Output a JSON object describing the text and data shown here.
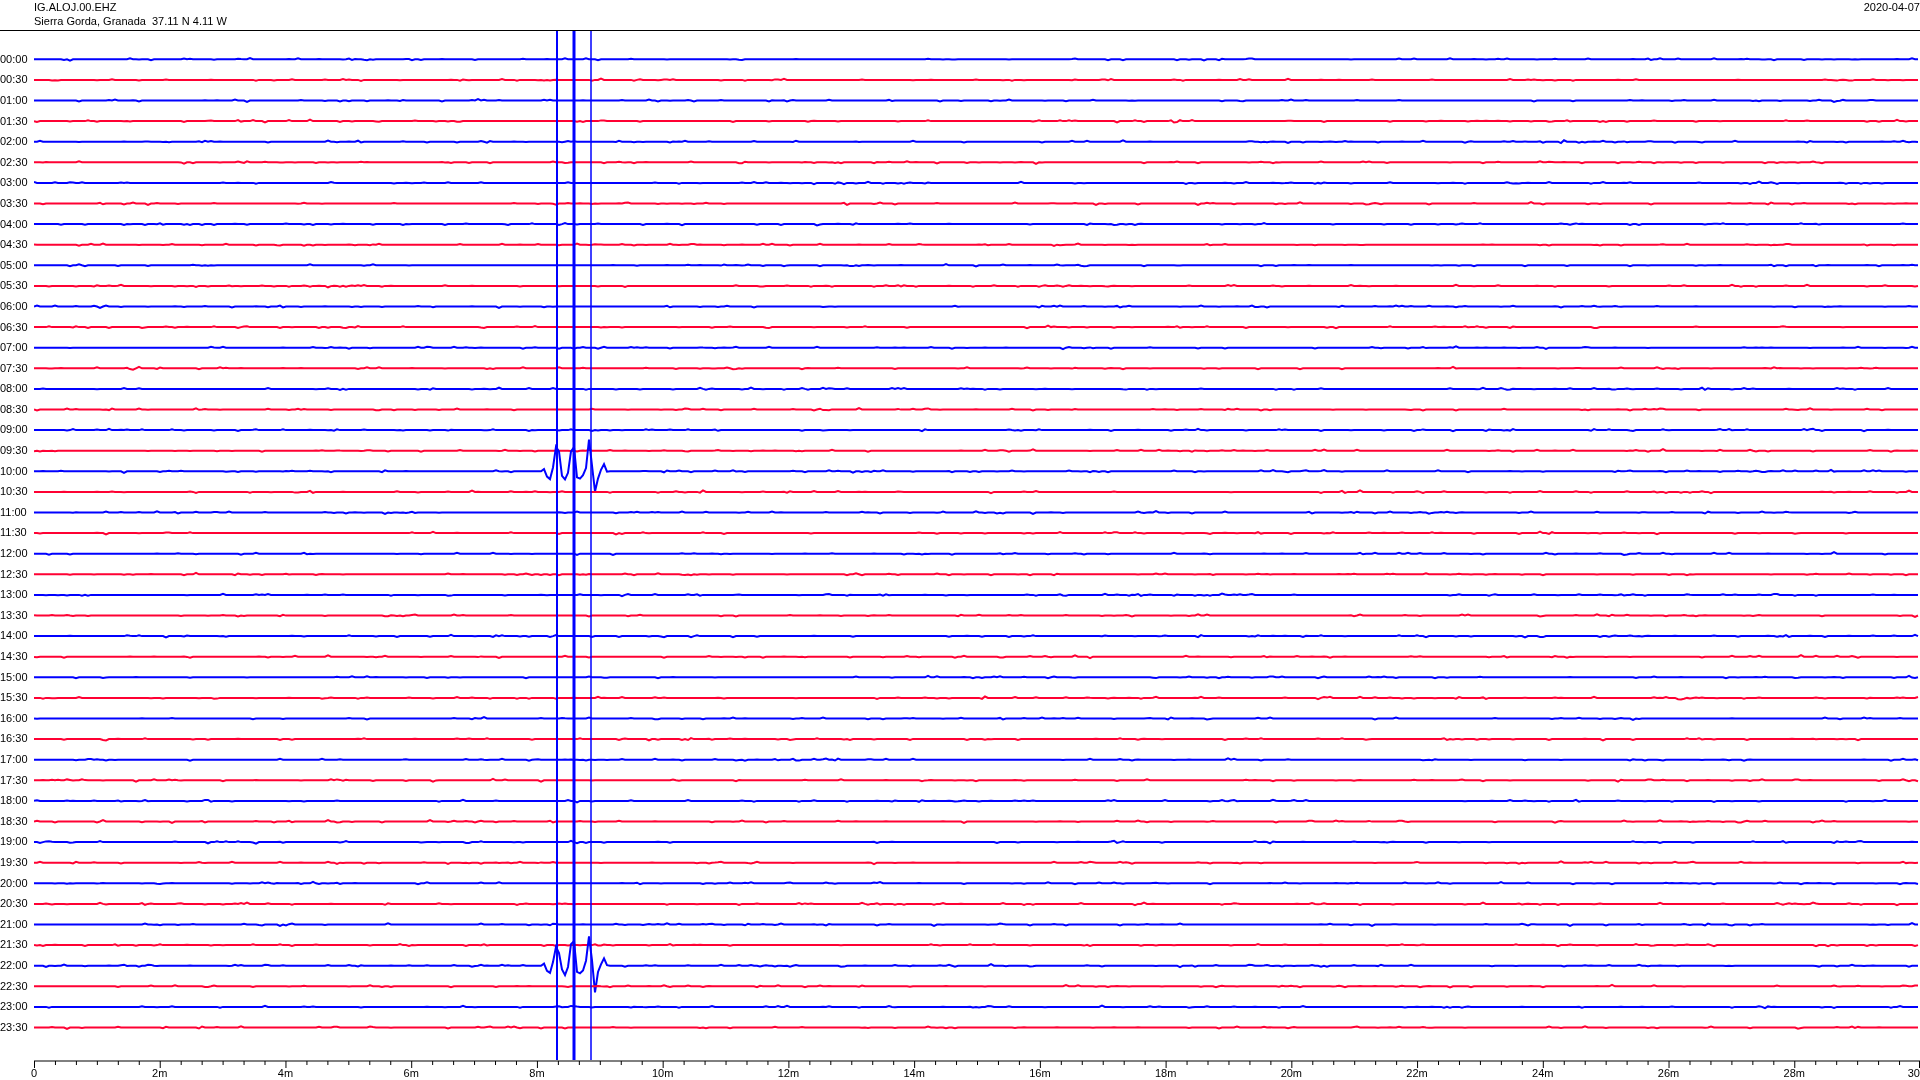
{
  "header": {
    "title": "IG.ALOJ.00.EHZ",
    "location": "Sierra Gorda, Granada  37.11 N 4.11 W",
    "date": "2020-04-07"
  },
  "rows": [
    {
      "label": "00:00",
      "color": "#0000ff"
    },
    {
      "label": "00:30",
      "color": "#ff0033"
    },
    {
      "label": "01:00",
      "color": "#0000ff"
    },
    {
      "label": "01:30",
      "color": "#ff0033"
    },
    {
      "label": "02:00",
      "color": "#0000ff"
    },
    {
      "label": "02:30",
      "color": "#ff0033"
    },
    {
      "label": "03:00",
      "color": "#0000ff"
    },
    {
      "label": "03:30",
      "color": "#ff0033"
    },
    {
      "label": "04:00",
      "color": "#0000ff"
    },
    {
      "label": "04:30",
      "color": "#ff0033"
    },
    {
      "label": "05:00",
      "color": "#0000ff"
    },
    {
      "label": "05:30",
      "color": "#ff0033"
    },
    {
      "label": "06:00",
      "color": "#0000ff"
    },
    {
      "label": "06:30",
      "color": "#ff0033"
    },
    {
      "label": "07:00",
      "color": "#0000ff"
    },
    {
      "label": "07:30",
      "color": "#ff0033"
    },
    {
      "label": "08:00",
      "color": "#0000ff"
    },
    {
      "label": "08:30",
      "color": "#ff0033"
    },
    {
      "label": "09:00",
      "color": "#0000ff"
    },
    {
      "label": "09:30",
      "color": "#ff0033"
    },
    {
      "label": "10:00",
      "color": "#0000ff"
    },
    {
      "label": "10:30",
      "color": "#ff0033"
    },
    {
      "label": "11:00",
      "color": "#0000ff"
    },
    {
      "label": "11:30",
      "color": "#ff0033"
    },
    {
      "label": "12:00",
      "color": "#0000ff"
    },
    {
      "label": "12:30",
      "color": "#ff0033"
    },
    {
      "label": "13:00",
      "color": "#0000ff"
    },
    {
      "label": "13:30",
      "color": "#ff0033"
    },
    {
      "label": "14:00",
      "color": "#0000ff"
    },
    {
      "label": "14:30",
      "color": "#ff0033"
    },
    {
      "label": "15:00",
      "color": "#0000ff"
    },
    {
      "label": "15:30",
      "color": "#ff0033"
    },
    {
      "label": "16:00",
      "color": "#0000ff"
    },
    {
      "label": "16:30",
      "color": "#ff0033"
    },
    {
      "label": "17:00",
      "color": "#0000ff"
    },
    {
      "label": "17:30",
      "color": "#ff0033"
    },
    {
      "label": "18:00",
      "color": "#0000ff"
    },
    {
      "label": "18:30",
      "color": "#ff0033"
    },
    {
      "label": "19:00",
      "color": "#0000ff"
    },
    {
      "label": "19:30",
      "color": "#ff0033"
    },
    {
      "label": "20:00",
      "color": "#0000ff"
    },
    {
      "label": "20:30",
      "color": "#ff0033"
    },
    {
      "label": "21:00",
      "color": "#0000ff"
    },
    {
      "label": "21:30",
      "color": "#ff0033"
    },
    {
      "label": "22:00",
      "color": "#0000ff"
    },
    {
      "label": "22:30",
      "color": "#ff0033"
    },
    {
      "label": "23:00",
      "color": "#0000ff"
    },
    {
      "label": "23:30",
      "color": "#ff0033"
    }
  ],
  "x_axis": {
    "labels": [
      "0",
      "2m",
      "4m",
      "6m",
      "8m",
      "10m",
      "12m",
      "14m",
      "16m",
      "18m",
      "20m",
      "22m",
      "24m",
      "26m",
      "28m",
      "30"
    ]
  }
}
